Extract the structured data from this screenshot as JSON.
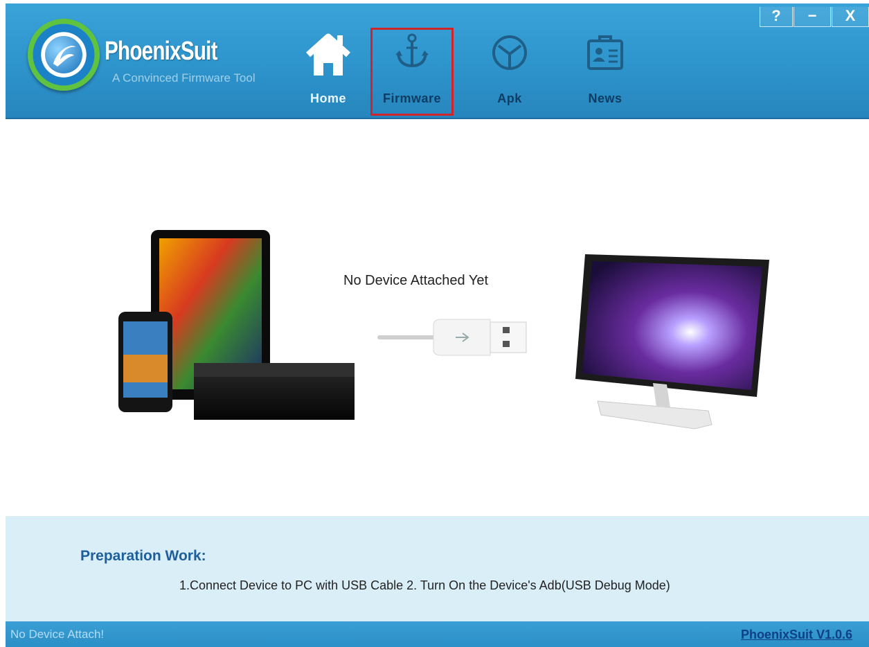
{
  "app": {
    "name": "PhoenixSuit",
    "tagline": "A Convinced Firmware Tool"
  },
  "nav": [
    {
      "label": "Home",
      "icon": "home-icon"
    },
    {
      "label": "Firmware",
      "icon": "anchor-icon",
      "selected": true
    },
    {
      "label": "Apk",
      "icon": "apk-icon"
    },
    {
      "label": "News",
      "icon": "news-icon"
    }
  ],
  "window_buttons": {
    "help": "?",
    "minimize": "−",
    "close": "X"
  },
  "main": {
    "status_message": "No Device Attached Yet"
  },
  "preparation": {
    "title": "Preparation Work:",
    "steps": "1.Connect Device to PC with USB Cable  2. Turn On the Device's Adb(USB Debug Mode)"
  },
  "statusbar": {
    "left": "No Device Attach!",
    "version_link": "PhoenixSuit V1.0.6"
  },
  "colors": {
    "header": "#2e94cc",
    "selected_outline": "#d0232a",
    "prep_bg": "#daeef7",
    "title_blue": "#1d5e9d"
  }
}
